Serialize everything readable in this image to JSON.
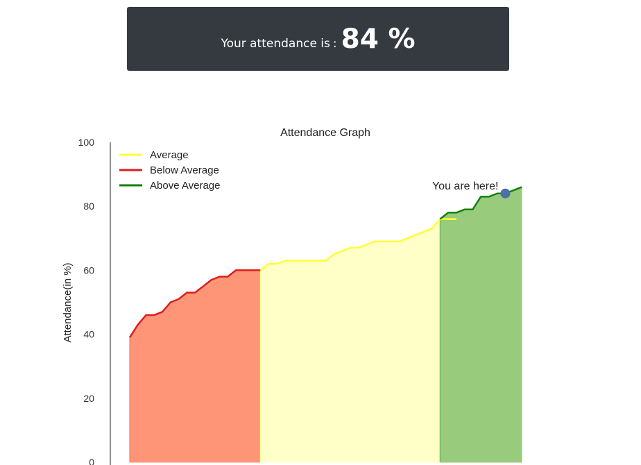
{
  "banner": {
    "label": "Your attendance is",
    "colon": ":",
    "value": "84 %"
  },
  "chart_data": {
    "type": "area",
    "title": "Attendance Graph",
    "xlabel": "",
    "ylabel": "Attendance(in %)",
    "ylim": [
      0,
      100
    ],
    "yticks": [
      0,
      20,
      40,
      60,
      80,
      100
    ],
    "grid": false,
    "legend_position": "top-left",
    "series": [
      {
        "name": "Below Average",
        "color": "#dd1c1c",
        "fill": "#ff9577",
        "x": [
          0,
          1,
          2,
          3,
          4,
          5,
          6,
          7,
          8,
          9,
          10,
          11,
          12,
          13,
          14,
          15,
          16
        ],
        "values": [
          39,
          43,
          46,
          46,
          47,
          50,
          51,
          53,
          53,
          55,
          57,
          58,
          58,
          60,
          60,
          60,
          60
        ]
      },
      {
        "name": "Average",
        "color": "#ffff33",
        "fill": "#ffffc8",
        "x": [
          16,
          17,
          18,
          19,
          20,
          21,
          22,
          23,
          24,
          25,
          26,
          27,
          28,
          29,
          30,
          31,
          32,
          33,
          34,
          35,
          36,
          37,
          38,
          39,
          40
        ],
        "values": [
          60,
          62,
          62,
          63,
          63,
          63,
          63,
          63,
          63,
          65,
          66,
          67,
          67,
          68,
          69,
          69,
          69,
          69,
          70,
          71,
          72,
          73,
          76,
          76,
          76
        ]
      },
      {
        "name": "Above Average",
        "color": "#157f0b",
        "fill": "#98cb7b",
        "x": [
          38,
          39,
          40,
          41,
          42,
          43,
          44,
          45,
          46,
          47,
          48
        ],
        "values": [
          76,
          78,
          78,
          79,
          79,
          83,
          83,
          84,
          84,
          85,
          86
        ]
      }
    ],
    "legend_order": [
      "Average",
      "Below Average",
      "Above Average"
    ],
    "marker": {
      "x": 46,
      "y": 84,
      "color": "#4a72a6",
      "label": "You are here!"
    }
  }
}
